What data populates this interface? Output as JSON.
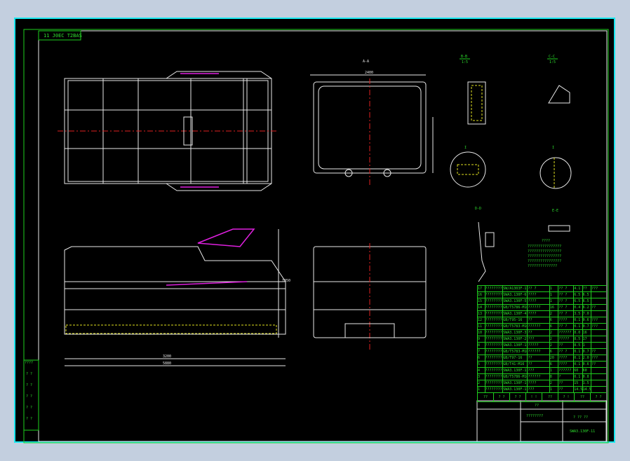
{
  "drawing_label": "11 J0EC T2BAS",
  "section_labels": {
    "aa": "A-A",
    "bb": "B-B",
    "cc": "C-C",
    "i": "I",
    "dd": "D-D",
    "ee": "E-E",
    "scale": "1:5"
  },
  "notes_title": "????",
  "notes": [
    "????????????????",
    "????????????????",
    "????????????????",
    "????????????????",
    "??????????????"
  ],
  "dimensions": {
    "overall_length": "5880",
    "mid": "3200",
    "width": "2400",
    "height": "1850"
  },
  "parts_table": {
    "header": [
      "??",
      "? ?",
      "? ?",
      "! !",
      "??",
      "? !",
      "??",
      "? ?"
    ],
    "rows": [
      [
        "17",
        "????????",
        "SW/A1303F-1",
        "?? ?",
        "1",
        "?? ?",
        "4.1",
        "??",
        "???"
      ],
      [
        "16",
        "????????",
        "SWA3.130F-6",
        "????",
        "1",
        "?? ?",
        "6.5",
        "6.5",
        ""
      ],
      [
        "15",
        "????????",
        "SWA3.130F-5",
        "????",
        "1",
        "?? ?",
        "6.5",
        "6.5",
        ""
      ],
      [
        "14",
        "????????",
        "GB/T5786-M16",
        "??????",
        "16",
        "?? ?",
        "0.4",
        "6.2",
        "??"
      ],
      [
        "13",
        "????????",
        "SWA3.130F-4",
        "????",
        "2",
        "?? ?",
        "3.5",
        "7.0",
        ""
      ],
      [
        "12",
        "????????",
        "GB/T95-16",
        "??",
        "6",
        "????",
        "0.1",
        "0.6",
        "???"
      ],
      [
        "11",
        "????????",
        "GB/T5783-M10",
        "??????",
        "6",
        "?? ?",
        "0.1",
        "0.7",
        "???"
      ],
      [
        "10",
        "????????",
        "SWA3.130F-3",
        "??",
        "2",
        "??????",
        "8.0",
        "16",
        ""
      ],
      [
        "9",
        "????????",
        "SWA3.130F-2",
        "???",
        "2",
        "?????",
        "8.5",
        "17",
        ""
      ],
      [
        "8",
        "????????",
        "SWA3.130F-1",
        "?????",
        "2",
        "??",
        "8.5",
        "1",
        ""
      ],
      [
        "7",
        "????????",
        "GB/T5783-M16",
        "??????",
        "6",
        "?? ?",
        "0.1",
        "0.7",
        "??"
      ],
      [
        "6",
        "????????",
        "GB/T97-16",
        "??",
        "20",
        "????",
        "0.1",
        "2.0",
        "???"
      ],
      [
        "5",
        "????????",
        "GB/T41-M16",
        "??",
        "6",
        "????",
        "0.1",
        "0.6",
        "??"
      ],
      [
        "4",
        "????????",
        "SWA3.130F-1",
        "???",
        "1",
        "??????",
        "60",
        "60",
        ""
      ],
      [
        "3",
        "????????",
        "GB/T5786-M16",
        "??????",
        "8",
        "?",
        "0.1",
        "0.8",
        ""
      ],
      [
        "2",
        "????????",
        "SWA3.130F-1",
        "????",
        "2",
        "??",
        "15",
        "1.5",
        ""
      ],
      [
        "1",
        "????????",
        "SWA3.130F-1",
        "???",
        "1",
        "??",
        "14.5",
        "14.5",
        ""
      ]
    ]
  },
  "title_block": {
    "company": "??",
    "drawing_name": "????????",
    "material": "? ?? ??",
    "drawing_no": "SWA3.130F-11"
  },
  "side_block": [
    "????",
    "? ?",
    "? ?",
    "? ?",
    "? ?",
    "? ?"
  ]
}
